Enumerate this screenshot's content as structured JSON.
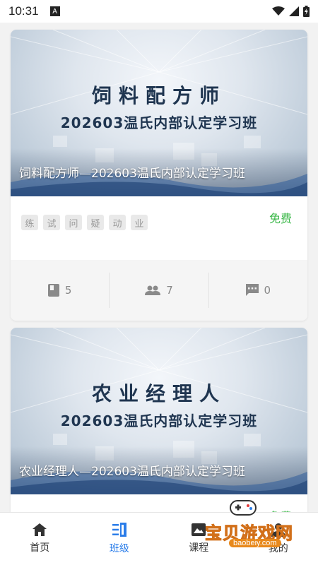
{
  "status_bar": {
    "time": "10:31",
    "notification_letter": "A"
  },
  "cards": [
    {
      "banner_title": "饲料配方师",
      "banner_subtitle": "202603温氏内部认定学习班",
      "caption": "饲料配方师—202603温氏内部认定学习班",
      "price": "免费",
      "tags": [
        "练",
        "试",
        "问",
        "疑",
        "动",
        "业"
      ],
      "stats": {
        "lessons": "5",
        "students": "7",
        "comments": "0"
      }
    },
    {
      "banner_title": "农业经理人",
      "banner_subtitle": "202603温氏内部认定学习班",
      "caption": "农业经理人—202603温氏内部认定学习班",
      "price": "免费"
    }
  ],
  "tab_bar": {
    "tabs": [
      {
        "label": "首页",
        "icon": "home-icon"
      },
      {
        "label": "班级",
        "icon": "class-icon",
        "active": true
      },
      {
        "label": "课程",
        "icon": "course-icon"
      },
      {
        "label": "我的",
        "icon": "profile-icon"
      }
    ],
    "active_color": "#2b7de9"
  },
  "watermark": {
    "text": "宝贝游戏网",
    "url": "baobeiy.com"
  },
  "colors": {
    "price": "#3cb84a",
    "banner_text": "#1f3550"
  }
}
